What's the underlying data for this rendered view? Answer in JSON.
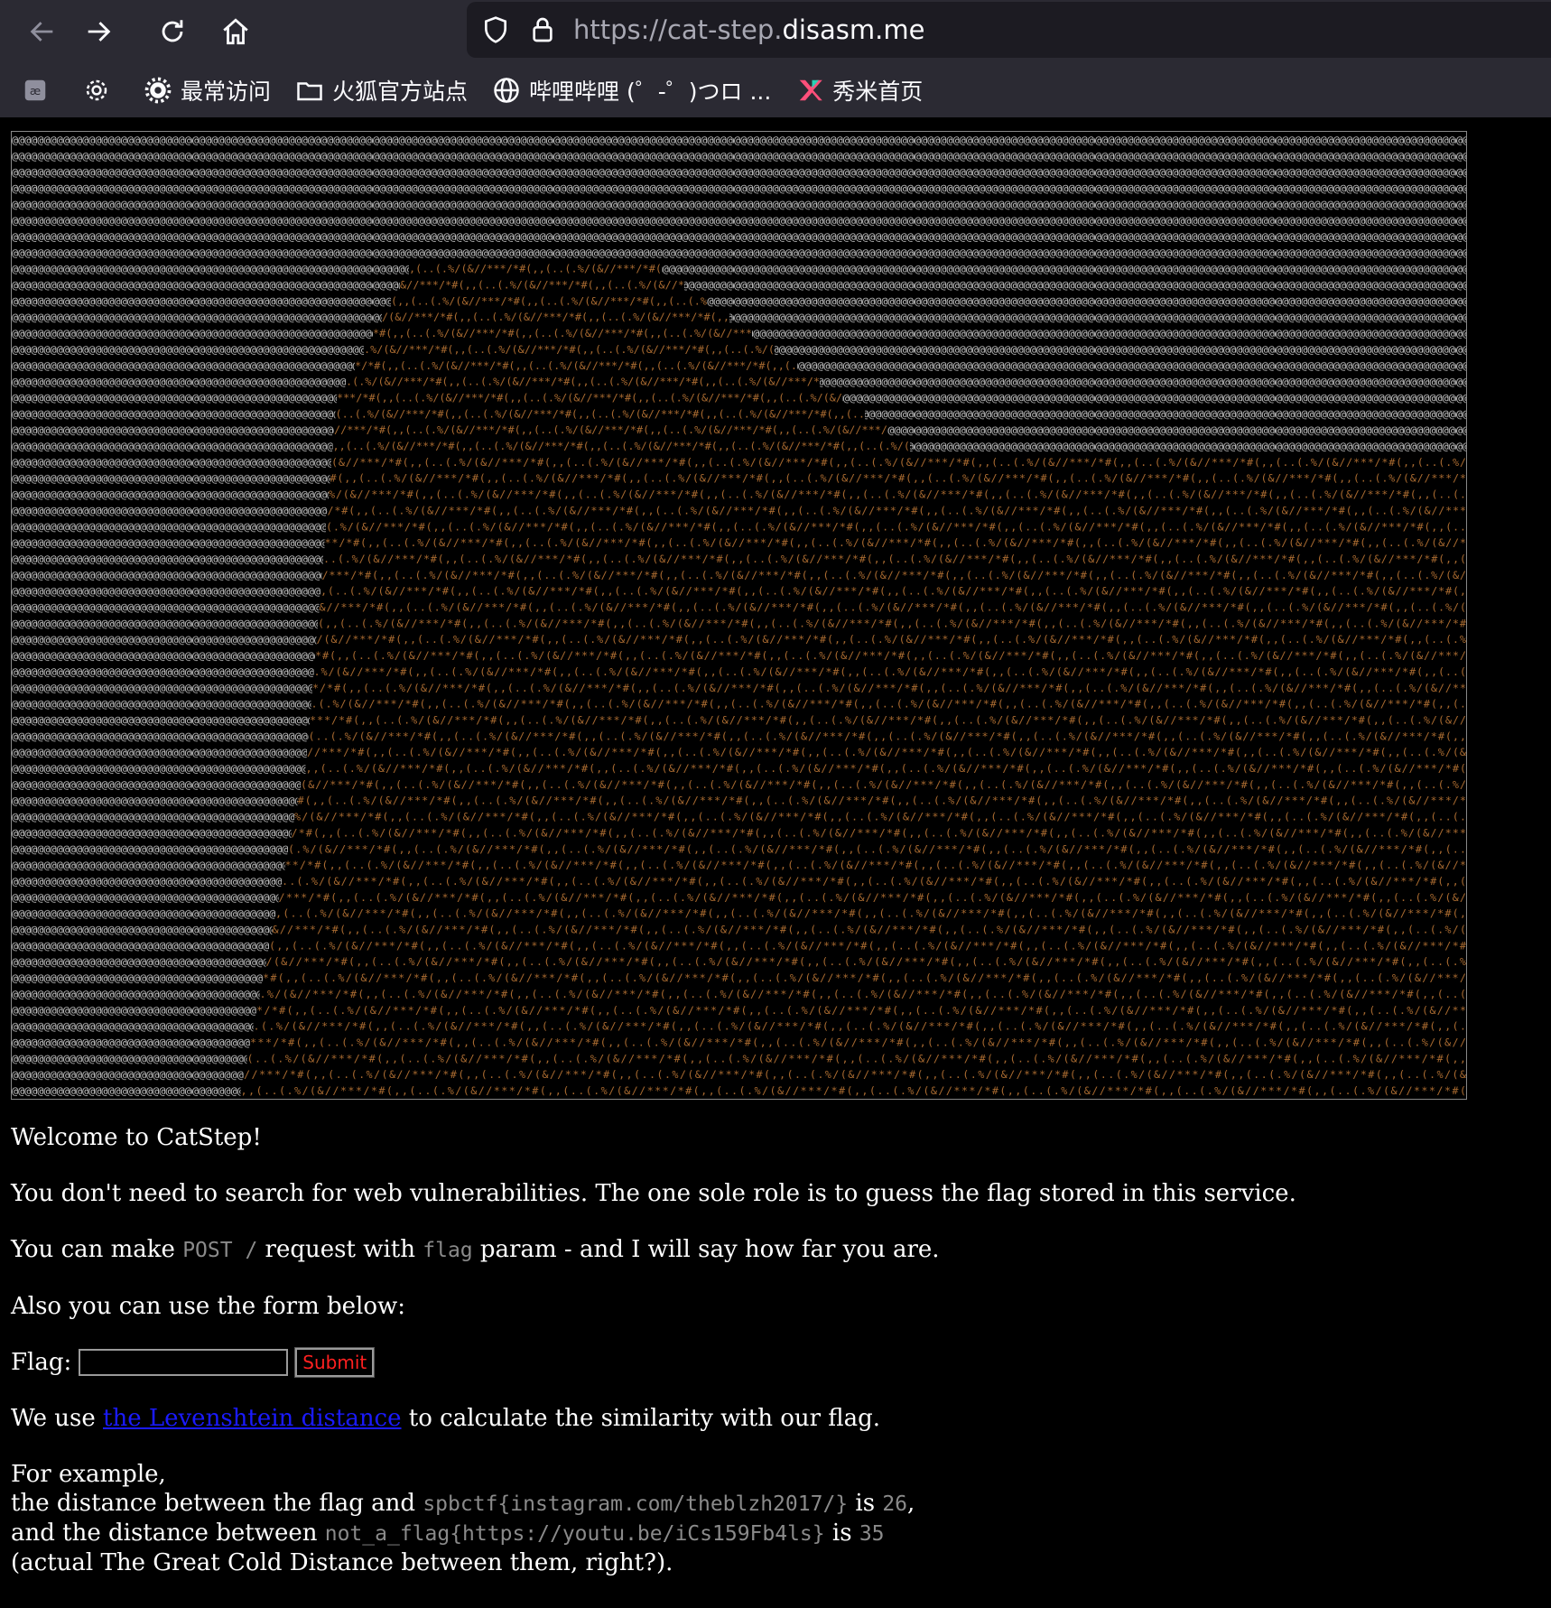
{
  "browser": {
    "url_scheme": "https://cat-step.",
    "url_domain": "disasm.me",
    "bookmarks": [
      {
        "label": "",
        "icon": "reader-icon"
      },
      {
        "label": "",
        "icon": "gear-icon"
      },
      {
        "label": "最常访问",
        "icon": "gear-icon"
      },
      {
        "label": "火狐官方站点",
        "icon": "folder-icon"
      },
      {
        "label": "哔哩哔哩 (゜-゜)つロ ...",
        "icon": "globe-icon"
      },
      {
        "label": "秀米首页",
        "icon": "xiumi-logo-icon"
      }
    ]
  },
  "page": {
    "welcome": "Welcome to CatStep!",
    "intro": "You don't need to search for web vulnerabilities. The one sole role is to guess the flag stored in this service.",
    "post_prefix": "You can make ",
    "post_code": "POST /",
    "post_mid": " request with ",
    "flag_code": "flag",
    "post_suffix": " param - and I will say how far you are.",
    "form_intro": "Also you can use the form below:",
    "flag_label": "Flag:",
    "flag_value": "",
    "submit_label": "Submit",
    "lev_prefix": "We use ",
    "lev_link": "the Levenshtein distance",
    "lev_suffix": " to calculate the similarity with our flag.",
    "example_line": "For example,",
    "ex1_prefix": "the distance between the flag and ",
    "ex1_code": "spbctf{instagram.com/theblzh2017/}",
    "ex1_is": " is ",
    "ex1_value": "26",
    "ex1_suffix": ",",
    "ex2_prefix": "and the distance between ",
    "ex2_code": "not_a_flag{https://youtu.be/iCs159Fb4ls}",
    "ex2_is": " is ",
    "ex2_value": "35",
    "closing": "(actual The Great Cold Distance between them, right?)."
  },
  "colors": {
    "art_fg": "#c8c8c8",
    "art_cat": "#a86a30",
    "link": "#1a1aff",
    "submit_text": "#ff2020",
    "code": "#8a8a8a"
  }
}
